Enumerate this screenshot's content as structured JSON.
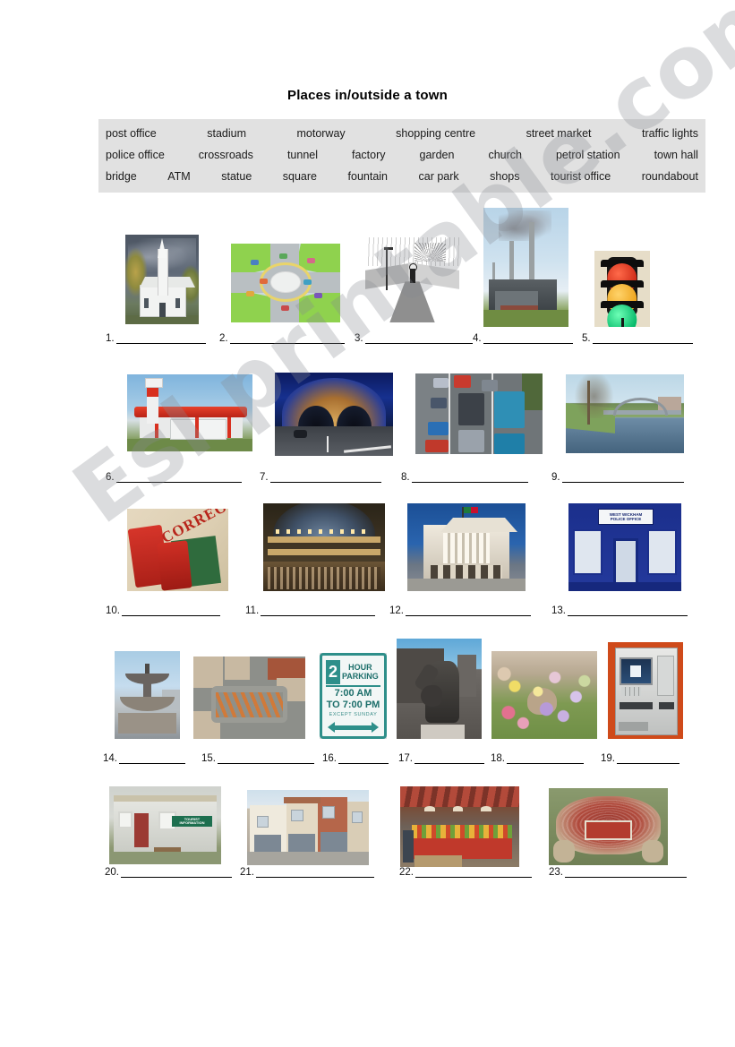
{
  "title": "Places in/outside a town",
  "watermark": "Esl printable.com",
  "word_bank": {
    "rows": [
      [
        "post office",
        "stadium",
        "motorway",
        "shopping centre",
        "street market",
        "traffic lights"
      ],
      [
        "police office",
        "crossroads",
        "tunnel",
        "factory",
        "garden",
        "church",
        "petrol station",
        "town hall"
      ],
      [
        "bridge",
        "ATM",
        "statue",
        "square",
        "fountain",
        "car park",
        "shops",
        "tourist office",
        "roundabout"
      ]
    ],
    "background_color": "#e1e1e1"
  },
  "items": [
    {
      "number": "1.",
      "picture": "church"
    },
    {
      "number": "2.",
      "picture": "roundabout"
    },
    {
      "number": "3.",
      "picture": "crossroads"
    },
    {
      "number": "4.",
      "picture": "factory"
    },
    {
      "number": "5.",
      "picture": "traffic-lights"
    },
    {
      "number": "6.",
      "picture": "petrol-station"
    },
    {
      "number": "7.",
      "picture": "tunnel"
    },
    {
      "number": "8.",
      "picture": "motorway"
    },
    {
      "number": "9.",
      "picture": "bridge"
    },
    {
      "number": "10.",
      "picture": "post-office"
    },
    {
      "number": "11.",
      "picture": "shopping-centre"
    },
    {
      "number": "12.",
      "picture": "town-hall"
    },
    {
      "number": "13.",
      "picture": "police-office"
    },
    {
      "number": "14.",
      "picture": "fountain"
    },
    {
      "number": "15.",
      "picture": "square"
    },
    {
      "number": "16.",
      "picture": "car-park"
    },
    {
      "number": "17.",
      "picture": "statue"
    },
    {
      "number": "18.",
      "picture": "garden"
    },
    {
      "number": "19.",
      "picture": "atm"
    },
    {
      "number": "20.",
      "picture": "tourist-office"
    },
    {
      "number": "21.",
      "picture": "shops"
    },
    {
      "number": "22.",
      "picture": "street-market"
    },
    {
      "number": "23.",
      "picture": "stadium"
    }
  ],
  "picture_text": {
    "post_office_sign": "CORREOS",
    "police_sign_line1": "WEST WICKHAM",
    "police_sign_line2": "POLICE OFFICE",
    "car_park_number": "2",
    "car_park_hour": "HOUR",
    "car_park_parking": "PARKING",
    "car_park_time_from": "7:00 AM",
    "car_park_time_to": "TO 7:00 PM",
    "car_park_except": "EXCEPT  SUNDAY",
    "tourist_sign_line1": "TOURIST",
    "tourist_sign_line2": "INFORMATION"
  }
}
